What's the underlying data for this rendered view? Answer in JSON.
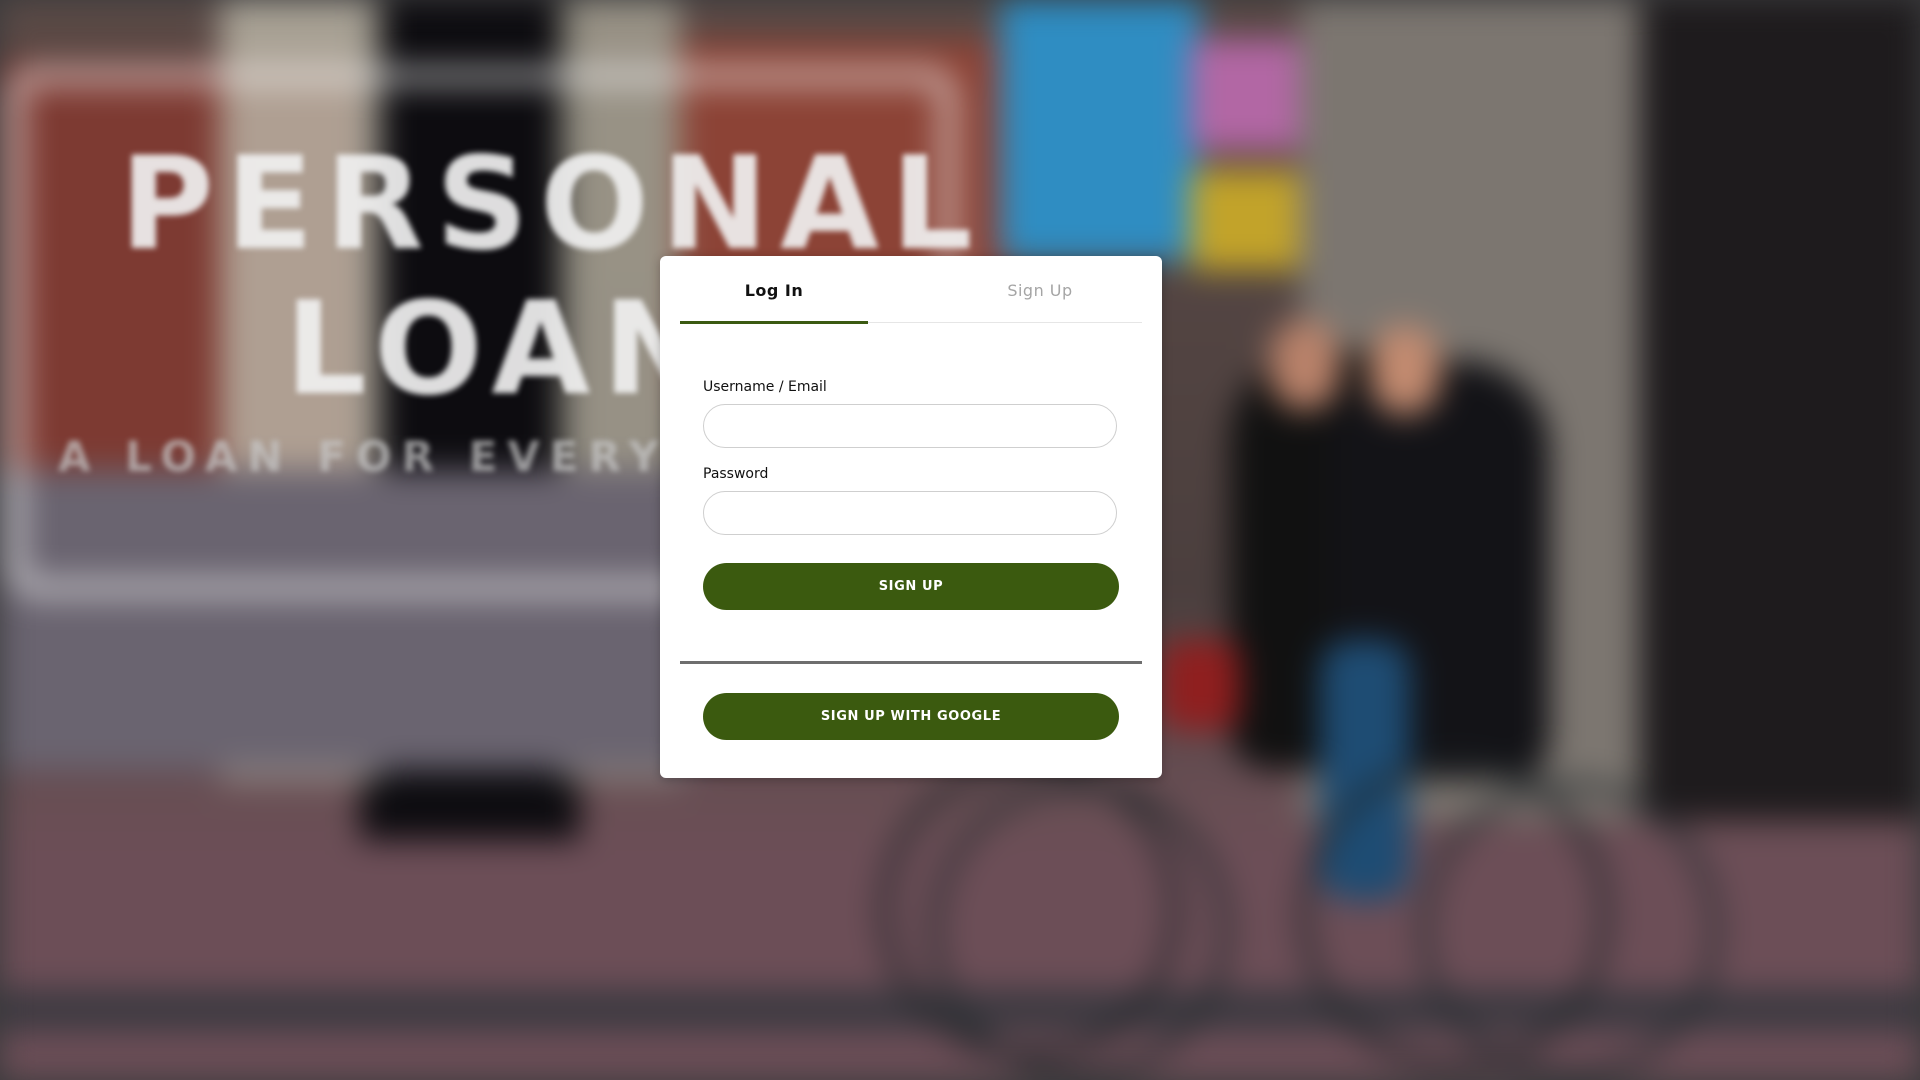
{
  "background": {
    "sign_line1": "PERSONAL",
    "sign_line2": "LOAN",
    "sign_line3": "A LOAN FOR EVERY POS"
  },
  "tabs": [
    {
      "label": "Log In",
      "active": true
    },
    {
      "label": "Sign Up",
      "active": false
    }
  ],
  "form": {
    "username_label": "Username / Email",
    "username_value": "",
    "password_label": "Password",
    "password_value": "",
    "submit_label": "SIGN UP",
    "google_label": "SIGN UP WITH GOOGLE"
  },
  "colors": {
    "accent": "#3b5a0f",
    "inactive_tab": "#a5a5a5"
  }
}
